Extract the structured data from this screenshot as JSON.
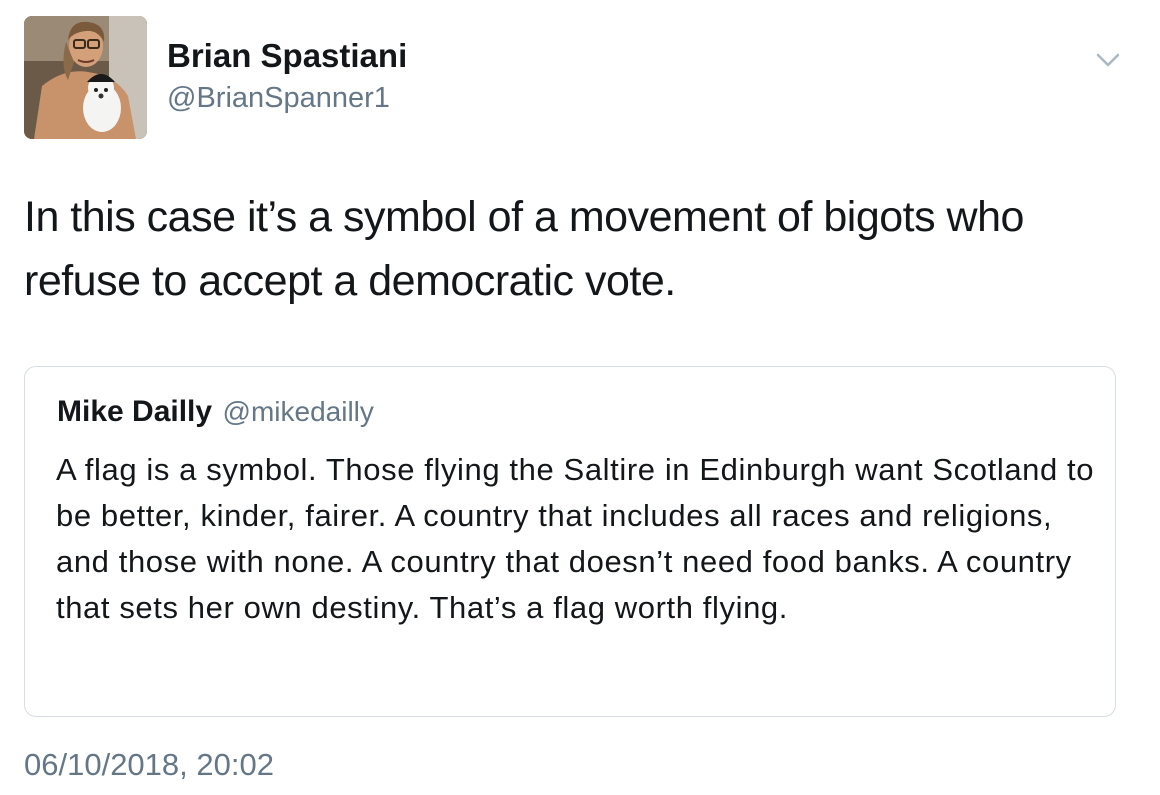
{
  "tweet": {
    "author": {
      "name": "Brian Spastiani",
      "handle": "@BrianSpanner1",
      "avatar_icon": "profile-photo"
    },
    "menu_icon": "chevron-down-icon",
    "text": "In this case it’s a symbol of a movement of bigots who refuse to accept a democratic vote.",
    "timestamp": "06/10/2018, 20:02"
  },
  "quoted_tweet": {
    "name": "Mike Dailly",
    "handle": "@mikedailly",
    "text": "A flag is a symbol. Those flying the Saltire in Edinburgh want Scotland to be better, kinder, fairer. A country that includes all races and religions, and those with none. A country that doesn’t need food banks. A country that sets her own destiny. That’s a flag worth flying."
  },
  "colors": {
    "text_primary": "#14171a",
    "text_secondary": "#657786",
    "border": "#d6dde3",
    "background": "#ffffff"
  }
}
